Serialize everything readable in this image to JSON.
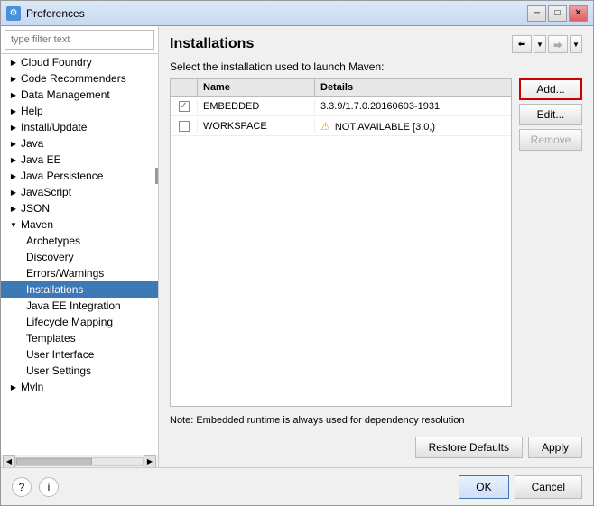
{
  "window": {
    "title": "Preferences",
    "icon": "⚙"
  },
  "titlebar_buttons": {
    "minimize": "─",
    "maximize": "□",
    "close": "✕"
  },
  "left_panel": {
    "filter_placeholder": "type filter text",
    "tree_items": [
      {
        "id": "cloud-foundry",
        "label": "Cloud Foundry",
        "level": 0,
        "expandable": true,
        "expanded": false
      },
      {
        "id": "code-recommenders",
        "label": "Code Recommenders",
        "level": 0,
        "expandable": true,
        "expanded": false
      },
      {
        "id": "data-management",
        "label": "Data Management",
        "level": 0,
        "expandable": true,
        "expanded": false
      },
      {
        "id": "help",
        "label": "Help",
        "level": 0,
        "expandable": true,
        "expanded": false
      },
      {
        "id": "install-update",
        "label": "Install/Update",
        "level": 0,
        "expandable": true,
        "expanded": false
      },
      {
        "id": "java",
        "label": "Java",
        "level": 0,
        "expandable": true,
        "expanded": false
      },
      {
        "id": "java-ee",
        "label": "Java EE",
        "level": 0,
        "expandable": true,
        "expanded": false
      },
      {
        "id": "java-persistence",
        "label": "Java Persistence",
        "level": 0,
        "expandable": true,
        "expanded": false
      },
      {
        "id": "javascript",
        "label": "JavaScript",
        "level": 0,
        "expandable": true,
        "expanded": false
      },
      {
        "id": "json",
        "label": "JSON",
        "level": 0,
        "expandable": true,
        "expanded": false
      },
      {
        "id": "maven",
        "label": "Maven",
        "level": 0,
        "expandable": true,
        "expanded": true
      },
      {
        "id": "archetypes",
        "label": "Archetypes",
        "level": 1,
        "expandable": false,
        "expanded": false
      },
      {
        "id": "discovery",
        "label": "Discovery",
        "level": 1,
        "expandable": false,
        "expanded": false
      },
      {
        "id": "errors-warnings",
        "label": "Errors/Warnings",
        "level": 1,
        "expandable": false,
        "expanded": false
      },
      {
        "id": "installations",
        "label": "Installations",
        "level": 1,
        "expandable": false,
        "expanded": false,
        "selected": true
      },
      {
        "id": "java-ee-integration",
        "label": "Java EE Integration",
        "level": 1,
        "expandable": false,
        "expanded": false
      },
      {
        "id": "lifecycle-mapping",
        "label": "Lifecycle Mapping",
        "level": 1,
        "expandable": false,
        "expanded": false
      },
      {
        "id": "templates",
        "label": "Templates",
        "level": 1,
        "expandable": false,
        "expanded": false
      },
      {
        "id": "user-interface",
        "label": "User Interface",
        "level": 1,
        "expandable": false,
        "expanded": false
      },
      {
        "id": "user-settings",
        "label": "User Settings",
        "level": 1,
        "expandable": false,
        "expanded": false
      },
      {
        "id": "mvln",
        "label": "Mvln",
        "level": 0,
        "expandable": true,
        "expanded": false
      }
    ]
  },
  "right_panel": {
    "title": "Installations",
    "subtitle": "Select the installation used to launch Maven:",
    "table": {
      "headers": [
        "",
        "Name",
        "Details"
      ],
      "rows": [
        {
          "checked": true,
          "name": "EMBEDDED",
          "details": "3.3.9/1.7.0.20160603-1931",
          "warning": false
        },
        {
          "checked": false,
          "name": "WORKSPACE",
          "details": "NOT AVAILABLE [3.0,)",
          "warning": true
        }
      ]
    },
    "buttons": {
      "add": "Add...",
      "edit": "Edit...",
      "remove": "Remove"
    },
    "note": "Note: Embedded runtime is always used for dependency resolution",
    "bottom_buttons": {
      "restore_defaults": "Restore Defaults",
      "apply": "Apply"
    }
  },
  "footer": {
    "ok_label": "OK",
    "cancel_label": "Cancel",
    "help_icon": "?",
    "info_icon": "i"
  },
  "colors": {
    "selected_bg": "#3d7ab5",
    "selected_text": "#ffffff",
    "add_btn_border": "#cc0000",
    "header_bg": "#dce9f7"
  }
}
